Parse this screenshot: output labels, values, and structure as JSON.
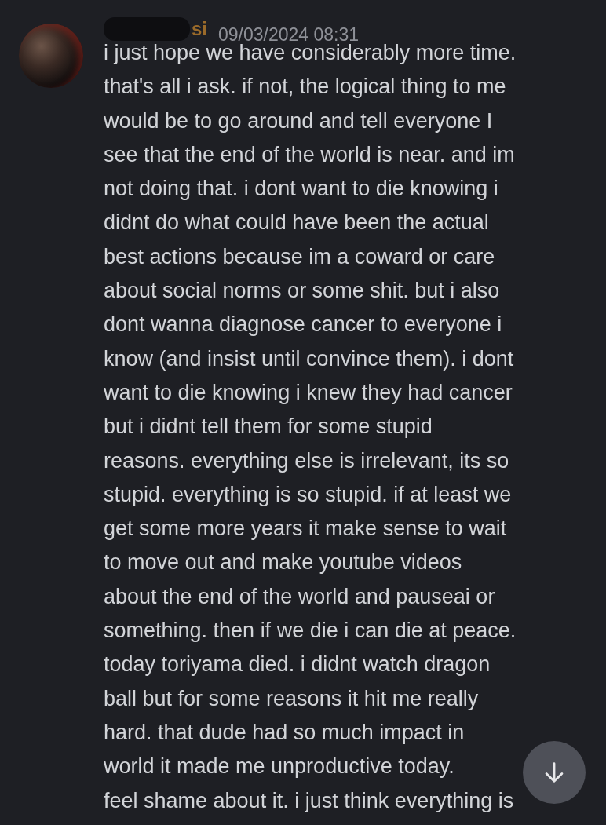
{
  "message": {
    "author": "si",
    "timestamp": "09/03/2024 08:31",
    "lines": [
      "i just hope we have considerably more time.",
      "that's all i ask. if not, the logical thing to me",
      "would be to go around and tell everyone I",
      "see that the end of the world is near. and im",
      "not doing that. i dont want to die knowing i",
      "didnt do what could have been the actual",
      "best actions because im a coward or care",
      "about social norms or some shit. but i also",
      "dont wanna diagnose cancer to everyone i",
      "know (and insist until convince them). i dont",
      "want to die knowing i knew they had cancer",
      "but i didnt tell them for some stupid",
      "reasons. everything else is irrelevant, its so",
      "stupid. everything is so stupid. if at least we",
      "get some more years it make sense to wait",
      "to move out and make youtube videos",
      "about the end of the world and pauseai or",
      "something. then if we die i can die at peace.",
      "today toriyama died. i didnt watch dragon",
      "ball but for some reasons it hit me really",
      "hard. that dude had so much impact in",
      "world it made me unproductive today.",
      "feel shame about it. i just think everything is"
    ]
  }
}
